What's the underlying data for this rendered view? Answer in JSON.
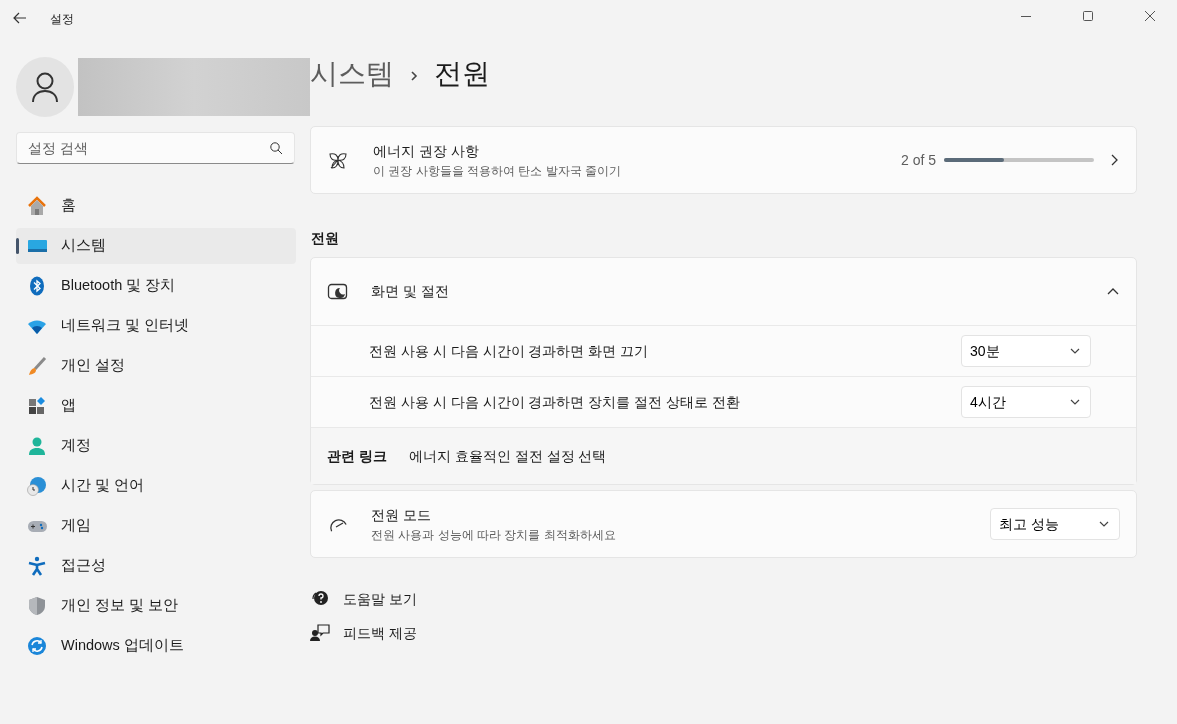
{
  "window": {
    "title": "설정"
  },
  "sidebar": {
    "search": {
      "placeholder": "설정 검색"
    },
    "items": [
      {
        "label": "홈",
        "selected": false
      },
      {
        "label": "시스템",
        "selected": true
      },
      {
        "label": "Bluetooth 및 장치",
        "selected": false
      },
      {
        "label": "네트워크 및 인터넷",
        "selected": false
      },
      {
        "label": "개인 설정",
        "selected": false
      },
      {
        "label": "앱",
        "selected": false
      },
      {
        "label": "계정",
        "selected": false
      },
      {
        "label": "시간 및 언어",
        "selected": false
      },
      {
        "label": "게임",
        "selected": false
      },
      {
        "label": "접근성",
        "selected": false
      },
      {
        "label": "개인 정보 및 보안",
        "selected": false
      },
      {
        "label": "Windows 업데이트",
        "selected": false
      }
    ]
  },
  "breadcrumb": [
    "시스템",
    "전원"
  ],
  "recommendation": {
    "title": "에너지 권장 사항",
    "subtitle": "이 권장 사항들을 적용하여 탄소 발자국 줄이기",
    "progress_text": "2 of 5",
    "level": 0.4
  },
  "section_title": "전원",
  "screen_sleep": {
    "title": "화면 및 절전",
    "expanded": true,
    "settings": [
      {
        "label": "전원 사용 시 다음 시간이 경과하면 화면 끄기",
        "value": "30분"
      },
      {
        "label": "전원 사용 시 다음 시간이 경과하면 장치를 절전 상태로 전환",
        "value": "4시간"
      }
    ],
    "related": {
      "label": "관련 링크",
      "link": "에너지 효율적인 절전 설정 선택"
    }
  },
  "power_mode": {
    "title": "전원 모드",
    "subtitle": "전원 사용과 성능에 따라 장치를 최적화하세요",
    "value": "최고 성능"
  },
  "help_links": [
    "도움말 보기",
    "피드백 제공"
  ]
}
